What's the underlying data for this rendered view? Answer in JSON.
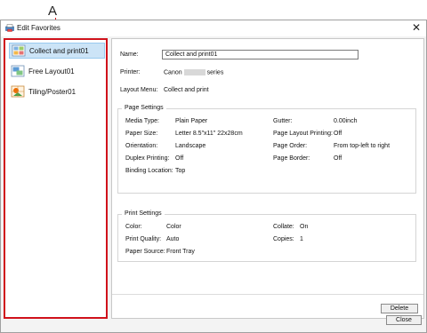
{
  "callout": {
    "letter": "A"
  },
  "window": {
    "title": "Edit Favorites",
    "close_glyph": "✕"
  },
  "favorites": [
    {
      "label": "Collect and print01",
      "icon": "collect-print-icon",
      "selected": true
    },
    {
      "label": "Free Layout01",
      "icon": "free-layout-icon",
      "selected": false
    },
    {
      "label": "Tiling/Poster01",
      "icon": "tiling-poster-icon",
      "selected": false
    }
  ],
  "details": {
    "name_label": "Name:",
    "name_value": "Collect and print01",
    "printer_label": "Printer:",
    "printer_value_prefix": "Canon",
    "printer_value_suffix": "series",
    "layout_menu_label": "Layout Menu:",
    "layout_menu_value": "Collect and print"
  },
  "page_settings": {
    "title": "Page Settings",
    "left": [
      {
        "label": "Media Type:",
        "value": "Plain Paper"
      },
      {
        "label": "Paper Size:",
        "value": "Letter 8.5\"x11\" 22x28cm"
      },
      {
        "label": "Orientation:",
        "value": "Landscape"
      },
      {
        "label": "Duplex Printing:",
        "value": "Off"
      },
      {
        "label": "Binding Location:",
        "value": "Top"
      }
    ],
    "right": [
      {
        "label": "Gutter:",
        "value": "0.00inch"
      },
      {
        "label": "Page Layout Printing:",
        "value": "Off"
      },
      {
        "label": "Page Order:",
        "value": "From top-left to right"
      },
      {
        "label": "Page Border:",
        "value": "Off"
      }
    ]
  },
  "print_settings": {
    "title": "Print Settings",
    "left": [
      {
        "label": "Color:",
        "value": "Color"
      },
      {
        "label": "Print Quality:",
        "value": "Auto"
      },
      {
        "label": "Paper Source:",
        "value": "Front Tray"
      }
    ],
    "right": [
      {
        "label": "Collate:",
        "value": "On"
      },
      {
        "label": "Copies:",
        "value": "1"
      }
    ]
  },
  "buttons": {
    "delete": "Delete",
    "close": "Close"
  },
  "colors": {
    "callout_red": "#d0121b",
    "selection_blue": "#cce4f7"
  }
}
